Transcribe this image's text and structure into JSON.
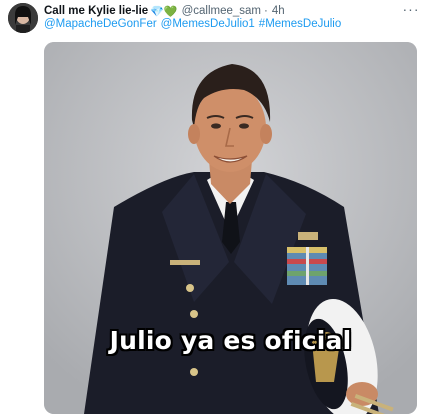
{
  "tweet": {
    "display_name": "Call me Kylie lie-lie",
    "name_emojis": "💎💚",
    "handle": "@callmee_sam",
    "dot": "·",
    "time": "4h",
    "more_label": "···",
    "mentions": [
      "@MapacheDeGonFer",
      "@MemesDeJulio1",
      "#MemesDeJulio"
    ],
    "image": {
      "caption": "Julio ya es oficial"
    }
  },
  "colors": {
    "link": "#1d9bf0",
    "secondary_text": "#536471",
    "uniform": "#1b1d29"
  }
}
